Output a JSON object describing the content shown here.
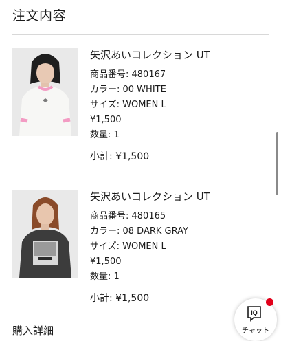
{
  "page": {
    "title": "注文内容"
  },
  "items": [
    {
      "name": "矢沢あいコレクション UT",
      "product_number": "商品番号: 480167",
      "color": "カラー: 00 WHITE",
      "size": "サイズ: WOMEN L",
      "price": "¥1,500",
      "quantity": "数量: 1",
      "subtotal": "小計: ¥1,500",
      "tshirt_color": "#f7f7f5",
      "trim_color": "#f39bc3"
    },
    {
      "name": "矢沢あいコレクション UT",
      "product_number": "商品番号: 480165",
      "color": "カラー: 08 DARK GRAY",
      "size": "サイズ: WOMEN L",
      "price": "¥1,500",
      "quantity": "数量: 1",
      "subtotal": "小計: ¥1,500",
      "tshirt_color": "#3c3c3c",
      "trim_color": "#3c3c3c"
    }
  ],
  "chat": {
    "label": "チャット",
    "icon": "iq-chat-icon",
    "badge_color": "#e2001a"
  },
  "next_section": {
    "title": "購入詳細"
  }
}
